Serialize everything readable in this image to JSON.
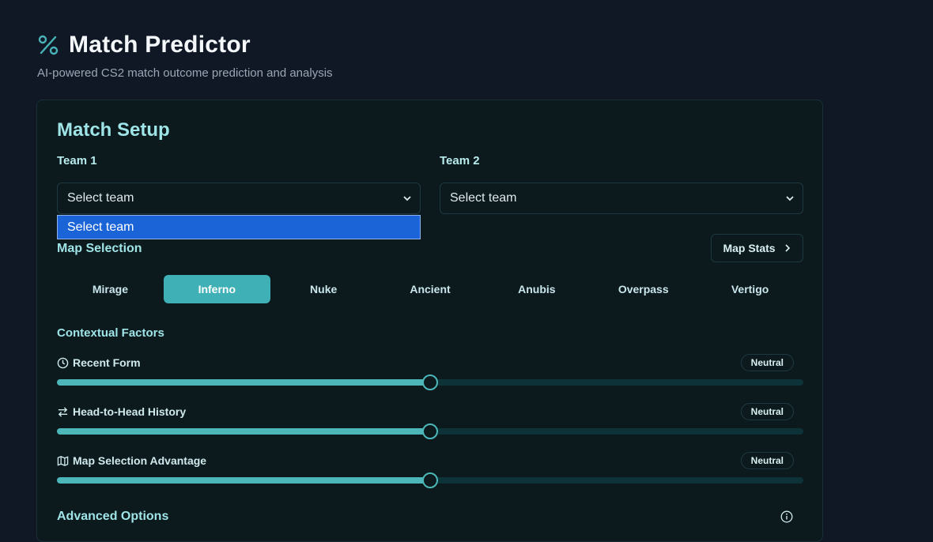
{
  "header": {
    "title": "Match Predictor",
    "subtitle": "AI-powered CS2 match outcome prediction and analysis",
    "icon": "percent-icon"
  },
  "setup": {
    "title": "Match Setup",
    "team1": {
      "label": "Team 1",
      "value": "Select team"
    },
    "team2": {
      "label": "Team 2",
      "value": "Select team"
    },
    "dropdown_options": [
      "Select team"
    ]
  },
  "map_selection": {
    "label": "Map Selection",
    "stats_button": "Map Stats",
    "maps": [
      "Mirage",
      "Inferno",
      "Nuke",
      "Ancient",
      "Anubis",
      "Overpass",
      "Vertigo"
    ],
    "selected": "Inferno"
  },
  "factors": {
    "label": "Contextual Factors",
    "items": [
      {
        "label": "Recent Form",
        "icon": "clock-icon",
        "badge": "Neutral",
        "value": 0.5
      },
      {
        "label": "Head-to-Head History",
        "icon": "swap-icon",
        "badge": "Neutral",
        "value": 0.5
      },
      {
        "label": "Map Selection Advantage",
        "icon": "map-icon",
        "badge": "Neutral",
        "value": 0.5
      }
    ]
  },
  "advanced": {
    "label": "Advanced Options",
    "icon": "info-icon"
  },
  "colors": {
    "accent": "#3fb0b5",
    "background": "#101826",
    "card": "#0c1a1e",
    "dropdown_highlight": "#1b64d8"
  }
}
